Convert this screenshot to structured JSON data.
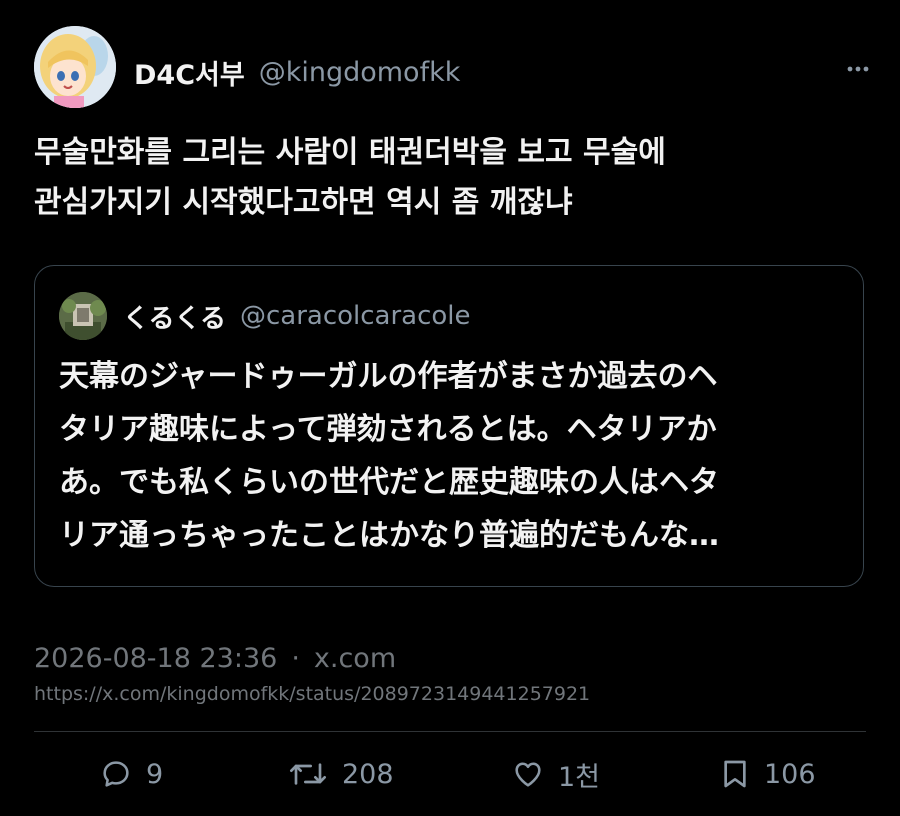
{
  "post": {
    "author_name": "D4C서부",
    "author_handle": "@kingdomofkk",
    "text_lines": [
      "무술만화를 그리는 사람이 태권더박을 보고 무술에",
      "관심가지기 시작했다고하면 역시 좀 깨잖냐"
    ]
  },
  "quote": {
    "author_name": "くるくる",
    "author_handle": "@caracolcaracole",
    "text_lines": [
      "天幕のジャードゥーガルの作者がまさか過去のヘ",
      "タリア趣味によって弾劾されるとは。ヘタリアか",
      "あ。でも私くらいの世代だと歴史趣味の人はヘタ",
      "リア通っちゃったことはかなり普遍的だもんな…"
    ]
  },
  "meta": {
    "timestamp": "2026-08-18 23:36",
    "separator": "·",
    "source": "x.com",
    "url": "https://x.com/kingdomofkk/status/2089723149441257921"
  },
  "actions": {
    "replies": "9",
    "reposts": "208",
    "likes": "1천",
    "bookmarks": "106"
  },
  "icons": {
    "more": "more-icon",
    "reply": "reply-icon",
    "repost": "repost-icon",
    "like": "heart-icon",
    "bookmark": "bookmark-icon"
  },
  "colors": {
    "background": "#000000",
    "text": "#e7e9ea",
    "muted": "#71767b",
    "border": "#38444d"
  }
}
